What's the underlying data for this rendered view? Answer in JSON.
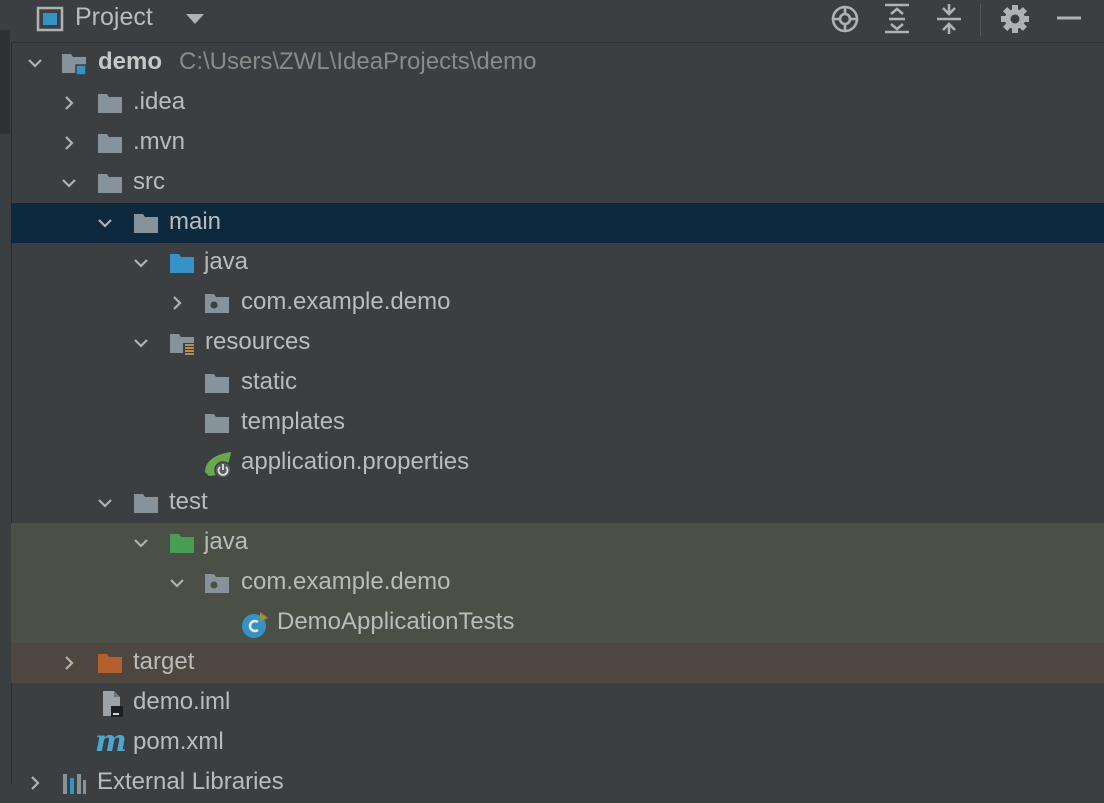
{
  "header": {
    "title": "Project",
    "buttons": [
      "locate-icon",
      "expand-all-icon",
      "collapse-all-icon",
      "gear-icon",
      "hide-icon"
    ]
  },
  "tree": {
    "root": {
      "name": "demo",
      "path": "C:\\Users\\ZWL\\IdeaProjects\\demo"
    },
    "idea": ".idea",
    "mvn": ".mvn",
    "src": "src",
    "main": "main",
    "main_java": "java",
    "main_pkg": "com.example.demo",
    "resources": "resources",
    "static": "static",
    "templates": "templates",
    "app_props": "application.properties",
    "test": "test",
    "test_java": "java",
    "test_pkg": "com.example.demo",
    "test_class": "DemoApplicationTests",
    "target": "target",
    "demo_iml": "demo.iml",
    "pom": "pom.xml",
    "ext_libs": "External Libraries"
  },
  "colors": {
    "panel_bg": "#3c3f41",
    "selected_bg": "#0d293e",
    "test_bg": "#4a5045",
    "excluded_bg": "#4d473f",
    "source_folder": "#3592c4",
    "test_folder": "#499c54",
    "excluded_folder": "#b55f2c",
    "folder": "#87939a"
  }
}
